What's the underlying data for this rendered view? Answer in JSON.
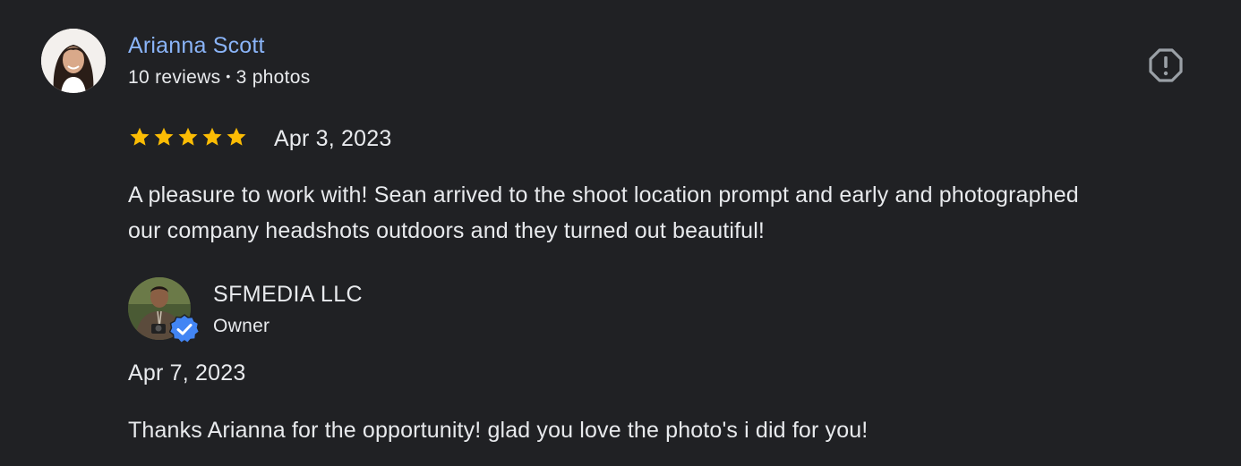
{
  "review": {
    "reviewer": {
      "name": "Arianna Scott",
      "reviews_count": "10 reviews",
      "separator": "•",
      "photos_count": "3 photos"
    },
    "rating": 5,
    "stars_filled_color": "#fbbc04",
    "date": "Apr 3, 2023",
    "text": "A pleasure to work with! Sean arrived to the shoot location prompt and early and photographed our company headshots outdoors and they turned out beautiful!",
    "report_icon": "report-octagon-icon"
  },
  "owner_reply": {
    "name": "SFMEDIA LLC",
    "role": "Owner",
    "verified_icon": "verified-badge-icon",
    "verified_color": "#4285f4",
    "date": "Apr 7, 2023",
    "text": "Thanks Arianna for the opportunity! glad you love the photo's i did for you!"
  },
  "colors": {
    "background": "#202124",
    "text": "#e8eaed",
    "link": "#8ab4f8"
  }
}
